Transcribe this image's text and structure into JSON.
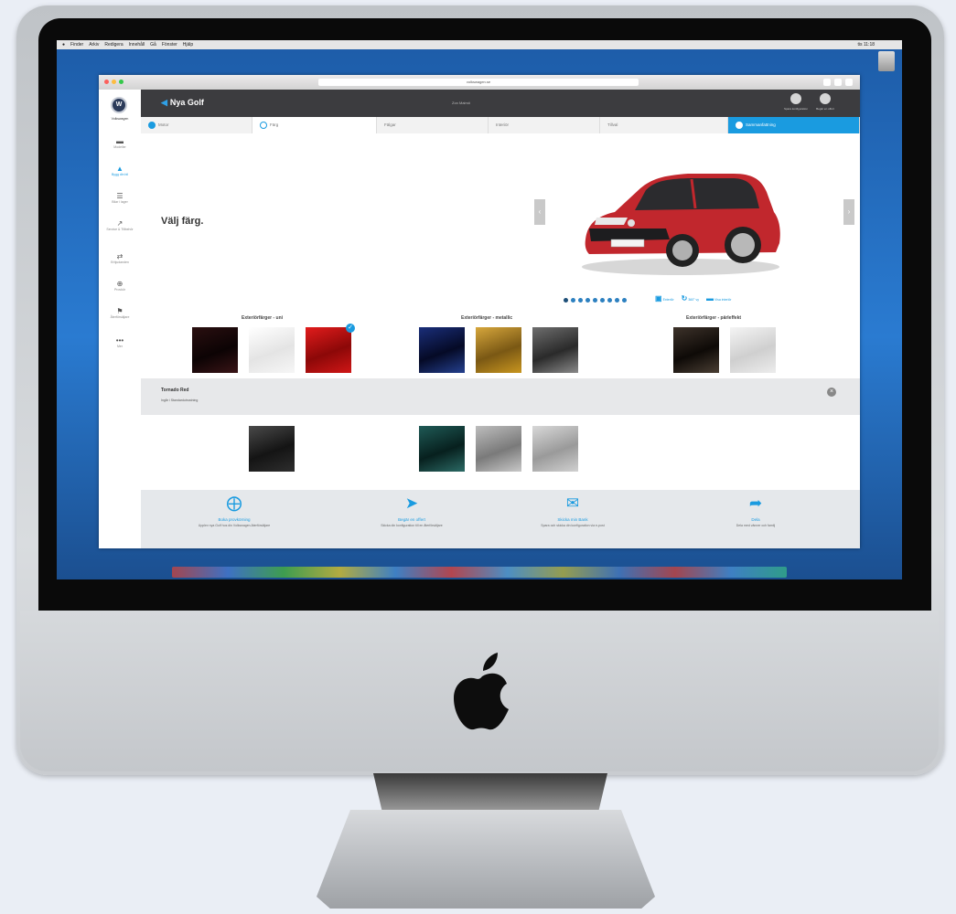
{
  "os": {
    "menubar": [
      "Finder",
      "Arkiv",
      "Redigera",
      "Innehåll",
      "Gå",
      "Fönster",
      "Hjälp"
    ],
    "clock": "tis 11:18"
  },
  "browser": {
    "url": "volkswagen.se"
  },
  "sidebar": {
    "brand": "Volkswagen",
    "items": [
      {
        "label": "Modeller",
        "icon": "car-icon"
      },
      {
        "label": "Bygg din bil",
        "icon": "build-car-icon"
      },
      {
        "label": "Bilar i lager",
        "icon": "stock-icon"
      },
      {
        "label": "Service & Tillbehör",
        "icon": "wrench-icon"
      },
      {
        "label": "Erbjudanden",
        "icon": "offers-icon"
      },
      {
        "label": "Provkör",
        "icon": "steering-wheel-icon"
      },
      {
        "label": "Återförsäljare",
        "icon": "dealer-icon"
      },
      {
        "label": "Mer",
        "icon": "more-icon"
      }
    ]
  },
  "header": {
    "back_label": "Nya Golf",
    "zip_label": "Zon Malmö",
    "actions": [
      {
        "label": "Spara konfiguration",
        "icon": "save-icon"
      },
      {
        "label": "Begär en offert",
        "icon": "offer-icon"
      }
    ]
  },
  "steps": [
    {
      "label": "Motor",
      "state": "done"
    },
    {
      "label": "Färg",
      "state": "current"
    },
    {
      "label": "Fälgar",
      "state": "todo"
    },
    {
      "label": "Interiör",
      "state": "todo"
    },
    {
      "label": "Tillval",
      "state": "todo"
    },
    {
      "label": "Sammanfattning",
      "state": "summary"
    }
  ],
  "main": {
    "title": "Välj färg.",
    "pager_count": 9,
    "pager_active": 0,
    "view_links": [
      "Exteriör",
      "360° vy",
      "Visa interiör"
    ],
    "groups": [
      {
        "label": "Exteriörfärger - uni"
      },
      {
        "label": "Exteriörfärger - metallic"
      },
      {
        "label": "Exteriörfärger - pärleffekt"
      }
    ],
    "selected": {
      "name": "Tornado Red",
      "subtitle": "Ingår i Standardutrustning"
    }
  },
  "footer": {
    "items": [
      {
        "title": "Boka provkörning",
        "desc": "Upplev nya Golf hos din Volkswagen-återförsäljare",
        "icon": "steering-wheel-icon"
      },
      {
        "title": "Begär en offert",
        "desc": "Skicka din konfiguration till en återförsäljare",
        "icon": "tag-icon"
      },
      {
        "title": "Skicka min Bank",
        "desc": "Spara och skicka din konfiguration via e-post",
        "icon": "mail-icon"
      },
      {
        "title": "Dela",
        "desc": "Dela med vänner och familj",
        "icon": "share-icon"
      }
    ]
  },
  "colors": {
    "accent": "#1a9be0",
    "topbar": "#3c3c3f",
    "car": "#c1272d"
  }
}
